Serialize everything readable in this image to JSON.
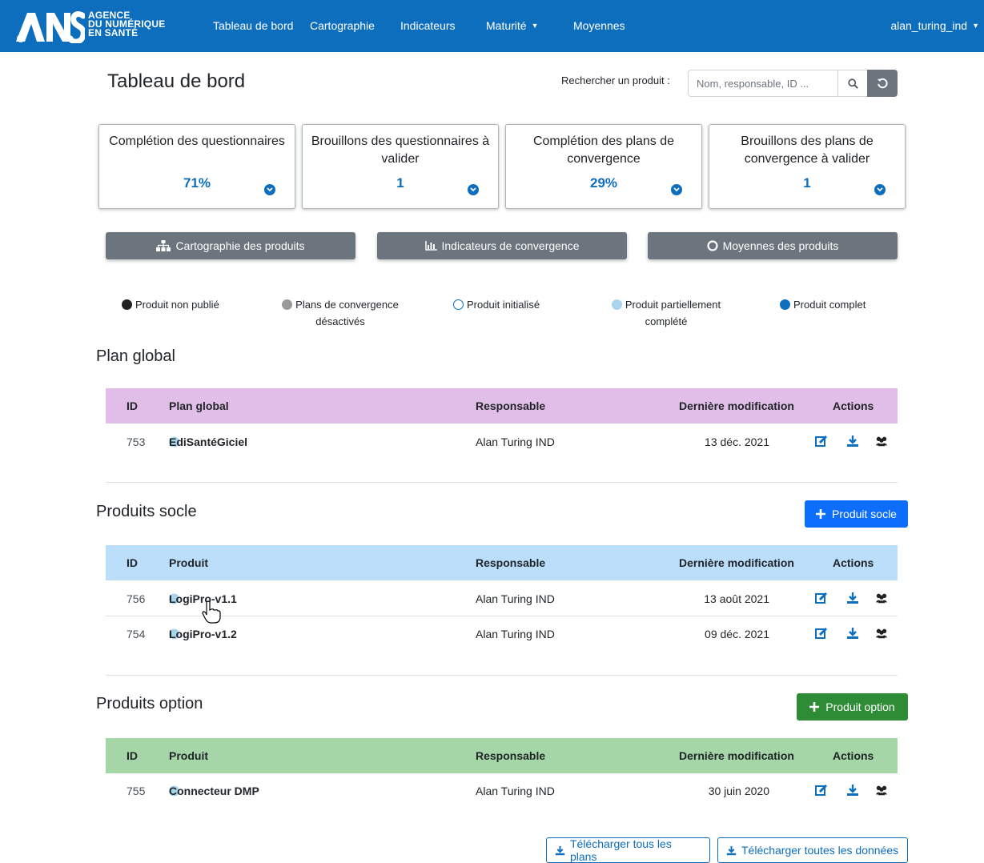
{
  "brand": {
    "line1": "AGENCE",
    "line2": "DU NUMÉRIQUE",
    "line3": "EN SANTÉ"
  },
  "nav": {
    "items": [
      "Tableau de bord",
      "Cartographie",
      "Indicateurs",
      "Maturité",
      "Moyennes"
    ],
    "user": "alan_turing_ind"
  },
  "header": {
    "title": "Tableau de bord",
    "search_label": "Rechercher un produit :",
    "search_placeholder": "Nom, responsable, ID ..."
  },
  "cards": [
    {
      "title": "Complétion des questionnaires",
      "value": "71%"
    },
    {
      "title": "Brouillons des questionnaires à valider",
      "value": "1"
    },
    {
      "title": "Complétion des plans de convergence",
      "value": "29%"
    },
    {
      "title": "Brouillons des plans de convergence à valider",
      "value": "1"
    }
  ],
  "actions": [
    {
      "label": "Cartographie des produits",
      "icon": "sitemap-icon"
    },
    {
      "label": "Indicateurs de convergence",
      "icon": "chart-icon"
    },
    {
      "label": "Moyennes des produits",
      "icon": "circle-icon"
    }
  ],
  "legend": [
    {
      "label": "Produit non publié",
      "color": "#222222"
    },
    {
      "label": "Plans de convergence désactivés",
      "color": "#999999"
    },
    {
      "label": "Produit initialisé",
      "color": "#ffffff"
    },
    {
      "label": "Produit partiellement complété",
      "color": "#a9d5ea"
    },
    {
      "label": "Produit complet",
      "color": "#0d6ebd"
    }
  ],
  "columns": {
    "id": "ID",
    "responsable": "Responsable",
    "date": "Dernière modification",
    "actions": "Actions"
  },
  "plan_global": {
    "title": "Plan global",
    "name_header": "Plan global",
    "header_color": "#e1bee7",
    "rows": [
      {
        "id": "753",
        "name": "EdiSantéGiciel",
        "responsable": "Alan Turing IND",
        "date": "13 déc. 2021"
      }
    ]
  },
  "socle": {
    "title": "Produits socle",
    "name_header": "Produit",
    "add_label": "Produit socle",
    "header_color": "#bbdefb",
    "button_color": "#0d6efd",
    "rows": [
      {
        "id": "756",
        "name": "LogiPro-v1.1",
        "responsable": "Alan Turing IND",
        "date": "13 août 2021"
      },
      {
        "id": "754",
        "name": "LogiPro-v1.2",
        "responsable": "Alan Turing IND",
        "date": "09 déc. 2021"
      }
    ]
  },
  "option": {
    "title": "Produits option",
    "name_header": "Produit",
    "add_label": "Produit option",
    "header_color": "#a5d6a7",
    "button_color": "#2e8b36",
    "rows": [
      {
        "id": "755",
        "name": "Connecteur DMP",
        "responsable": "Alan Turing IND",
        "date": "30 juin 2020"
      }
    ]
  },
  "footer": {
    "download_plans": "Télécharger tous les plans",
    "download_data": "Télécharger toutes les données"
  }
}
